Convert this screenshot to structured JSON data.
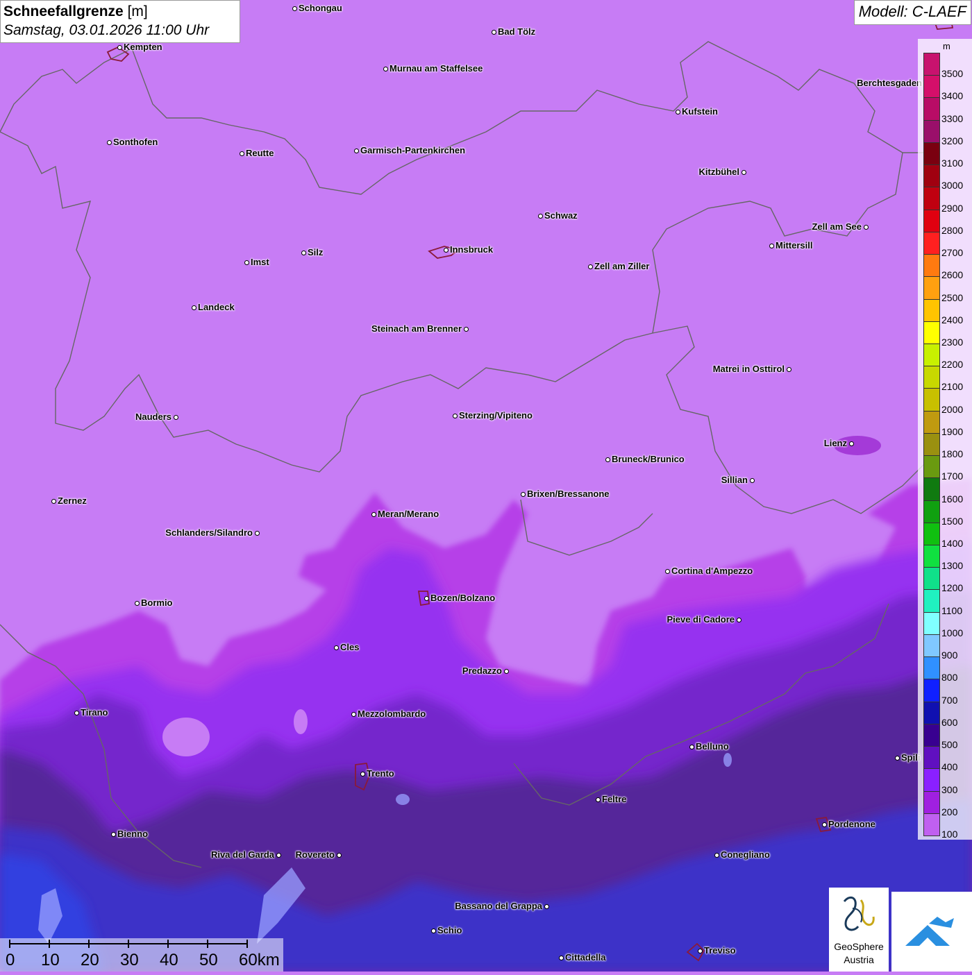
{
  "header": {
    "title": "Schneefallgrenze",
    "unit_suffix": "[m]",
    "datetime": "Samstag, 03.01.2026 11:00 Uhr",
    "model": "Modell: C-LAEF"
  },
  "legend": {
    "unit": "m",
    "entries": [
      {
        "label": "3500",
        "color": "#c8126e"
      },
      {
        "label": "3400",
        "color": "#d40f6a"
      },
      {
        "label": "3300",
        "color": "#b80c66"
      },
      {
        "label": "3200",
        "color": "#9a0f6a"
      },
      {
        "label": "3100",
        "color": "#7a0010"
      },
      {
        "label": "3000",
        "color": "#a00010"
      },
      {
        "label": "2900",
        "color": "#c00010"
      },
      {
        "label": "2800",
        "color": "#e00010"
      },
      {
        "label": "2700",
        "color": "#ff2020"
      },
      {
        "label": "2600",
        "color": "#ff7a10"
      },
      {
        "label": "2500",
        "color": "#ffa010"
      },
      {
        "label": "2400",
        "color": "#ffc400"
      },
      {
        "label": "2300",
        "color": "#ffff00"
      },
      {
        "label": "2200",
        "color": "#c8f000"
      },
      {
        "label": "2100",
        "color": "#c8d800"
      },
      {
        "label": "2000",
        "color": "#c8c000"
      },
      {
        "label": "1900",
        "color": "#c09a10"
      },
      {
        "label": "1800",
        "color": "#9a9010"
      },
      {
        "label": "1700",
        "color": "#6a9a10"
      },
      {
        "label": "1600",
        "color": "#107a10"
      },
      {
        "label": "1500",
        "color": "#10a010"
      },
      {
        "label": "1400",
        "color": "#10c010"
      },
      {
        "label": "1300",
        "color": "#10e040"
      },
      {
        "label": "1200",
        "color": "#10e08a"
      },
      {
        "label": "1100",
        "color": "#20f0c0"
      },
      {
        "label": "1000",
        "color": "#80ffff"
      },
      {
        "label": "900",
        "color": "#80c8ff"
      },
      {
        "label": "800",
        "color": "#3090ff"
      },
      {
        "label": "700",
        "color": "#1020ff"
      },
      {
        "label": "600",
        "color": "#1010b0"
      },
      {
        "label": "500",
        "color": "#380090"
      },
      {
        "label": "400",
        "color": "#6010c0"
      },
      {
        "label": "300",
        "color": "#8a20ff"
      },
      {
        "label": "200",
        "color": "#a020e0"
      },
      {
        "label": "100",
        "color": "#c060f0"
      }
    ]
  },
  "cities": [
    {
      "name": "Schongau"
    },
    {
      "name": "Bad Tölz"
    },
    {
      "name": "Kempten"
    },
    {
      "name": "Murnau am Staffelsee"
    },
    {
      "name": "Berchtesgaden"
    },
    {
      "name": "Kufstein"
    },
    {
      "name": "Sonthofen"
    },
    {
      "name": "Reutte"
    },
    {
      "name": "Garmisch-Partenkirchen"
    },
    {
      "name": "Kitzbühel"
    },
    {
      "name": "Schwaz"
    },
    {
      "name": "Zell am See"
    },
    {
      "name": "Innsbruck"
    },
    {
      "name": "Mittersill"
    },
    {
      "name": "Imst"
    },
    {
      "name": "Silz"
    },
    {
      "name": "Zell am Ziller"
    },
    {
      "name": "Landeck"
    },
    {
      "name": "Steinach am Brenner"
    },
    {
      "name": "Matrei in Osttirol"
    },
    {
      "name": "Nauders"
    },
    {
      "name": "Sterzing/Vipiteno"
    },
    {
      "name": "Lienz"
    },
    {
      "name": "Bruneck/Brunico"
    },
    {
      "name": "Sillian"
    },
    {
      "name": "Zernez"
    },
    {
      "name": "Brixen/Bressanone"
    },
    {
      "name": "Meran/Merano"
    },
    {
      "name": "Schlanders/Silandro"
    },
    {
      "name": "Cortina d'Ampezzo"
    },
    {
      "name": "Bozen/Bolzano"
    },
    {
      "name": "Bormio"
    },
    {
      "name": "Pieve di Cadore"
    },
    {
      "name": "Cles"
    },
    {
      "name": "Predazzo"
    },
    {
      "name": "Tirano"
    },
    {
      "name": "Mezzolombardo"
    },
    {
      "name": "Belluno"
    },
    {
      "name": "Spili"
    },
    {
      "name": "Trento"
    },
    {
      "name": "Feltre"
    },
    {
      "name": "Pordenone"
    },
    {
      "name": "Bienno"
    },
    {
      "name": "Riva del Garda"
    },
    {
      "name": "Rovereto"
    },
    {
      "name": "Conegliano"
    },
    {
      "name": "Bassano del Grappa"
    },
    {
      "name": "Schio"
    },
    {
      "name": "Treviso"
    },
    {
      "name": "Cittadella"
    }
  ],
  "scale": {
    "ticks": [
      "0",
      "10",
      "20",
      "30",
      "40",
      "50",
      "60km"
    ]
  },
  "logos": {
    "geosphere_line1": "GeoSphere",
    "geosphere_line2": "Austria"
  }
}
